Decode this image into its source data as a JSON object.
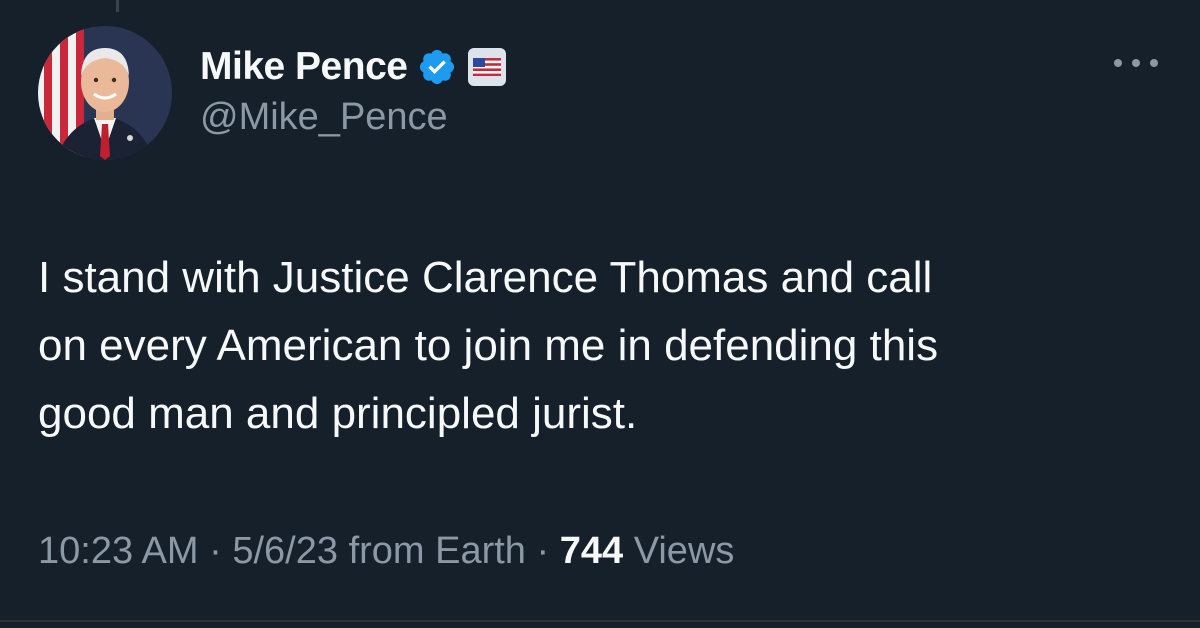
{
  "tweet": {
    "author": {
      "display_name": "Mike Pence",
      "handle": "@Mike_Pence",
      "verified": true,
      "verified_icon": "verified-badge-icon",
      "flag_icon": "us-flag-icon",
      "avatar": "profile-avatar"
    },
    "text_lines": [
      "I stand with Justice Clarence Thomas and call",
      "on every American to join me in defending this",
      "good man and principled jurist."
    ],
    "meta": {
      "time": "10:23 AM",
      "date": "5/6/23",
      "source": "from Earth",
      "sep": "·",
      "views_count": "744",
      "views_label": "Views"
    },
    "more_icon": "more-options-icon",
    "colors": {
      "background": "#15202b",
      "text": "#f7f9f9",
      "secondary": "#8b98a5",
      "verified_blue": "#1d9bf0"
    }
  }
}
